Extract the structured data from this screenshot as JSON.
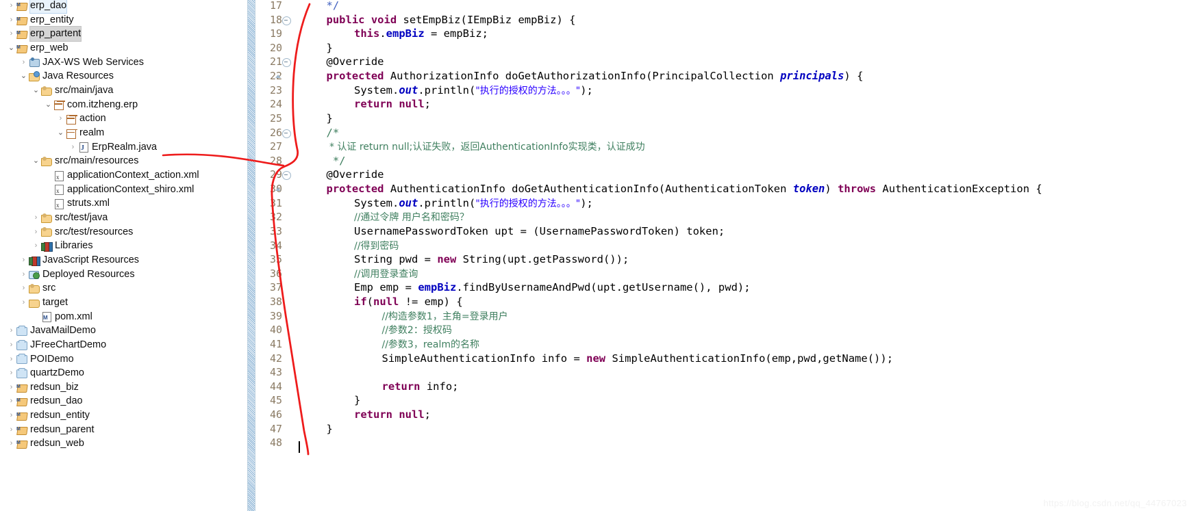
{
  "explorer": {
    "name": "package-explorer",
    "items": [
      {
        "label": "erp_dao",
        "icon": "maven-java-project-icon",
        "indent": 0,
        "twisty": "collapsed",
        "state": "sel-focus"
      },
      {
        "label": "erp_entity",
        "icon": "maven-java-project-icon",
        "indent": 0,
        "twisty": "collapsed",
        "state": "none"
      },
      {
        "label": "erp_partent",
        "icon": "maven-project-icon",
        "indent": 0,
        "twisty": "collapsed",
        "state": "sel-gray"
      },
      {
        "label": "erp_web",
        "icon": "maven-java-project-icon",
        "indent": 0,
        "twisty": "expanded",
        "state": "none"
      },
      {
        "label": "JAX-WS Web Services",
        "icon": "jaxws-icon",
        "indent": 1,
        "twisty": "collapsed",
        "state": "none"
      },
      {
        "label": "Java Resources",
        "icon": "java-resources-icon",
        "indent": 1,
        "twisty": "expanded",
        "state": "none"
      },
      {
        "label": "src/main/java",
        "icon": "source-folder-icon",
        "indent": 2,
        "twisty": "expanded",
        "state": "none"
      },
      {
        "label": "com.itzheng.erp",
        "icon": "package-icon",
        "indent": 3,
        "twisty": "expanded",
        "state": "none"
      },
      {
        "label": "action",
        "icon": "package-icon",
        "indent": 4,
        "twisty": "collapsed",
        "state": "none"
      },
      {
        "label": "realm",
        "icon": "package-icon",
        "indent": 4,
        "twisty": "expanded",
        "state": "none"
      },
      {
        "label": "ErpRealm.java",
        "icon": "java-file-icon",
        "indent": 5,
        "twisty": "collapsed",
        "state": "none"
      },
      {
        "label": "src/main/resources",
        "icon": "source-folder-icon",
        "indent": 2,
        "twisty": "expanded",
        "state": "none"
      },
      {
        "label": "applicationContext_action.xml",
        "icon": "xml-file-icon",
        "indent": 3,
        "twisty": "none",
        "state": "none"
      },
      {
        "label": "applicationContext_shiro.xml",
        "icon": "xml-file-icon",
        "indent": 3,
        "twisty": "none",
        "state": "none"
      },
      {
        "label": "struts.xml",
        "icon": "xml-file-icon",
        "indent": 3,
        "twisty": "none",
        "state": "none"
      },
      {
        "label": "src/test/java",
        "icon": "source-folder-icon",
        "indent": 2,
        "twisty": "collapsed",
        "state": "none"
      },
      {
        "label": "src/test/resources",
        "icon": "source-folder-icon",
        "indent": 2,
        "twisty": "collapsed",
        "state": "none"
      },
      {
        "label": "Libraries",
        "icon": "libraries-icon",
        "indent": 2,
        "twisty": "collapsed",
        "state": "none"
      },
      {
        "label": "JavaScript Resources",
        "icon": "libraries-icon",
        "indent": 1,
        "twisty": "collapsed",
        "state": "none"
      },
      {
        "label": "Deployed Resources",
        "icon": "deployed-resources-icon",
        "indent": 1,
        "twisty": "collapsed",
        "state": "none"
      },
      {
        "label": "src",
        "icon": "source-folder-icon",
        "indent": 1,
        "twisty": "collapsed",
        "state": "none"
      },
      {
        "label": "target",
        "icon": "folder-icon",
        "indent": 1,
        "twisty": "collapsed",
        "state": "none"
      },
      {
        "label": "pom.xml",
        "icon": "pom-file-icon",
        "indent": 2,
        "twisty": "none",
        "state": "none"
      },
      {
        "label": "JavaMailDemo",
        "icon": "project-icon",
        "indent": 0,
        "twisty": "collapsed",
        "state": "none"
      },
      {
        "label": "JFreeChartDemo",
        "icon": "project-icon",
        "indent": 0,
        "twisty": "collapsed",
        "state": "none"
      },
      {
        "label": "POIDemo",
        "icon": "project-icon",
        "indent": 0,
        "twisty": "collapsed",
        "state": "none"
      },
      {
        "label": "quartzDemo",
        "icon": "project-icon",
        "indent": 0,
        "twisty": "collapsed",
        "state": "none"
      },
      {
        "label": "redsun_biz",
        "icon": "maven-java-project-icon",
        "indent": 0,
        "twisty": "collapsed",
        "state": "none"
      },
      {
        "label": "redsun_dao",
        "icon": "maven-java-project-icon",
        "indent": 0,
        "twisty": "collapsed",
        "state": "none"
      },
      {
        "label": "redsun_entity",
        "icon": "maven-java-project-icon",
        "indent": 0,
        "twisty": "collapsed",
        "state": "none"
      },
      {
        "label": "redsun_parent",
        "icon": "maven-project-icon",
        "indent": 0,
        "twisty": "collapsed",
        "state": "none"
      },
      {
        "label": "redsun_web",
        "icon": "maven-java-project-icon",
        "indent": 0,
        "twisty": "collapsed",
        "state": "none"
      }
    ]
  },
  "editor": {
    "name": "java-code-editor",
    "first_line_number": 17,
    "lines": [
      {
        "n": 17,
        "fold": "none",
        "indent": 1,
        "tokens": [
          {
            "t": "*/",
            "c": "jd"
          }
        ]
      },
      {
        "n": 18,
        "fold": "circle",
        "indent": 1,
        "tokens": [
          {
            "t": "public ",
            "c": "kw"
          },
          {
            "t": "void ",
            "c": "kw"
          },
          {
            "t": "setEmpBiz(IEmpBiz empBiz) {",
            "c": "plain"
          }
        ]
      },
      {
        "n": 19,
        "fold": "none",
        "indent": 2,
        "tokens": [
          {
            "t": "this",
            "c": "kw"
          },
          {
            "t": ".",
            "c": "plain"
          },
          {
            "t": "empBiz",
            "c": "fld"
          },
          {
            "t": " = empBiz;",
            "c": "plain"
          }
        ]
      },
      {
        "n": 20,
        "fold": "none",
        "indent": 1,
        "tokens": [
          {
            "t": "}",
            "c": "plain"
          }
        ]
      },
      {
        "n": 21,
        "fold": "circle",
        "indent": 1,
        "tokens": [
          {
            "t": "@Override",
            "c": "plain"
          }
        ]
      },
      {
        "n": 22,
        "fold": "arrow",
        "indent": 1,
        "tokens": [
          {
            "t": "protected ",
            "c": "kw"
          },
          {
            "t": "AuthorizationInfo doGetAuthorizationInfo(PrincipalCollection ",
            "c": "plain"
          },
          {
            "t": "principals",
            "c": "sfld"
          },
          {
            "t": ") {",
            "c": "plain"
          }
        ]
      },
      {
        "n": 23,
        "fold": "none",
        "indent": 2,
        "tokens": [
          {
            "t": "System.",
            "c": "plain"
          },
          {
            "t": "out",
            "c": "sfld"
          },
          {
            "t": ".println(",
            "c": "plain"
          },
          {
            "t": "\"执行的授权的方法。。。\"",
            "c": "str"
          },
          {
            "t": ");",
            "c": "plain"
          }
        ]
      },
      {
        "n": 24,
        "fold": "none",
        "indent": 2,
        "tokens": [
          {
            "t": "return ",
            "c": "kw"
          },
          {
            "t": "null",
            "c": "kw"
          },
          {
            "t": ";",
            "c": "plain"
          }
        ]
      },
      {
        "n": 25,
        "fold": "none",
        "indent": 1,
        "tokens": [
          {
            "t": "}",
            "c": "plain"
          }
        ]
      },
      {
        "n": 26,
        "fold": "circle",
        "indent": 1,
        "tokens": [
          {
            "t": "/*",
            "c": "cm"
          }
        ]
      },
      {
        "n": 27,
        "fold": "none",
        "indent": 1,
        "tokens": [
          {
            "t": " * 认证 return null;认证失败，返回AuthenticationInfo实现类，认证成功",
            "c": "cm"
          }
        ]
      },
      {
        "n": 28,
        "fold": "none",
        "indent": 1,
        "tokens": [
          {
            "t": " */",
            "c": "cm"
          }
        ]
      },
      {
        "n": 29,
        "fold": "circle",
        "indent": 1,
        "tokens": [
          {
            "t": "@Override",
            "c": "plain"
          }
        ]
      },
      {
        "n": 30,
        "fold": "arrow",
        "indent": 1,
        "tokens": [
          {
            "t": "protected ",
            "c": "kw"
          },
          {
            "t": "AuthenticationInfo doGetAuthenticationInfo(AuthenticationToken ",
            "c": "plain"
          },
          {
            "t": "token",
            "c": "sfld"
          },
          {
            "t": ") ",
            "c": "plain"
          },
          {
            "t": "throws ",
            "c": "kw"
          },
          {
            "t": "AuthenticationException {",
            "c": "plain"
          }
        ]
      },
      {
        "n": 31,
        "fold": "none",
        "indent": 2,
        "tokens": [
          {
            "t": "System.",
            "c": "plain"
          },
          {
            "t": "out",
            "c": "sfld"
          },
          {
            "t": ".println(",
            "c": "plain"
          },
          {
            "t": "\"执行的授权的方法。。。\"",
            "c": "str"
          },
          {
            "t": ");",
            "c": "plain"
          }
        ]
      },
      {
        "n": 32,
        "fold": "none",
        "indent": 2,
        "tokens": [
          {
            "t": "//通过令牌 用户名和密码？",
            "c": "cm"
          }
        ]
      },
      {
        "n": 33,
        "fold": "none",
        "indent": 2,
        "tokens": [
          {
            "t": "UsernamePasswordToken upt = (UsernamePasswordToken) token;",
            "c": "plain"
          }
        ]
      },
      {
        "n": 34,
        "fold": "none",
        "indent": 2,
        "tokens": [
          {
            "t": "//得到密码",
            "c": "cm"
          }
        ]
      },
      {
        "n": 35,
        "fold": "none",
        "indent": 2,
        "tokens": [
          {
            "t": "String pwd = ",
            "c": "plain"
          },
          {
            "t": "new ",
            "c": "kw"
          },
          {
            "t": "String(upt.getPassword());",
            "c": "plain"
          }
        ]
      },
      {
        "n": 36,
        "fold": "none",
        "indent": 2,
        "tokens": [
          {
            "t": "//调用登录查询",
            "c": "cm"
          }
        ]
      },
      {
        "n": 37,
        "fold": "none",
        "indent": 2,
        "tokens": [
          {
            "t": "Emp emp = ",
            "c": "plain"
          },
          {
            "t": "empBiz",
            "c": "fld"
          },
          {
            "t": ".findByUsernameAndPwd(upt.getUsername(), pwd);",
            "c": "plain"
          }
        ]
      },
      {
        "n": 38,
        "fold": "none",
        "indent": 2,
        "tokens": [
          {
            "t": "if",
            "c": "kw"
          },
          {
            "t": "(",
            "c": "plain"
          },
          {
            "t": "null ",
            "c": "kw"
          },
          {
            "t": "!= emp) {",
            "c": "plain"
          }
        ]
      },
      {
        "n": 39,
        "fold": "none",
        "indent": 3,
        "tokens": [
          {
            "t": "//构造参数1，主角=登录用户",
            "c": "cm"
          }
        ]
      },
      {
        "n": 40,
        "fold": "none",
        "indent": 3,
        "tokens": [
          {
            "t": "//参数2：授权码",
            "c": "cm"
          }
        ]
      },
      {
        "n": 41,
        "fold": "none",
        "indent": 3,
        "tokens": [
          {
            "t": "//参数3，realm的名称",
            "c": "cm"
          }
        ]
      },
      {
        "n": 42,
        "fold": "none",
        "indent": 3,
        "tokens": [
          {
            "t": "SimpleAuthenticationInfo info = ",
            "c": "plain"
          },
          {
            "t": "new ",
            "c": "kw"
          },
          {
            "t": "SimpleAuthenticationInfo(emp,pwd,getName());",
            "c": "plain"
          }
        ]
      },
      {
        "n": 43,
        "fold": "none",
        "indent": 0,
        "tokens": []
      },
      {
        "n": 44,
        "fold": "none",
        "indent": 3,
        "tokens": [
          {
            "t": "return ",
            "c": "kw"
          },
          {
            "t": "info;",
            "c": "plain"
          }
        ]
      },
      {
        "n": 45,
        "fold": "none",
        "indent": 2,
        "tokens": [
          {
            "t": "}",
            "c": "plain"
          }
        ]
      },
      {
        "n": 46,
        "fold": "none",
        "indent": 2,
        "tokens": [
          {
            "t": "return ",
            "c": "kw"
          },
          {
            "t": "null",
            "c": "kw"
          },
          {
            "t": ";",
            "c": "plain"
          }
        ]
      },
      {
        "n": 47,
        "fold": "none",
        "indent": 1,
        "tokens": [
          {
            "t": "}",
            "c": "plain"
          }
        ]
      },
      {
        "n": 48,
        "fold": "none",
        "indent": 0,
        "tokens": []
      }
    ]
  },
  "watermark": {
    "text": "https://blog.csdn.net/qq_44767023"
  },
  "colors": {
    "keyword": "#7f0055",
    "comment": "#3f7f5f",
    "javadoc": "#3f5fbf",
    "string": "#2a00ff",
    "field": "#0000c0",
    "selection_focus": "#e8f2fb",
    "selection_gray": "#d6d6d6",
    "annotation_line": "#ee1c1c",
    "line_number": "#8a7a63"
  }
}
